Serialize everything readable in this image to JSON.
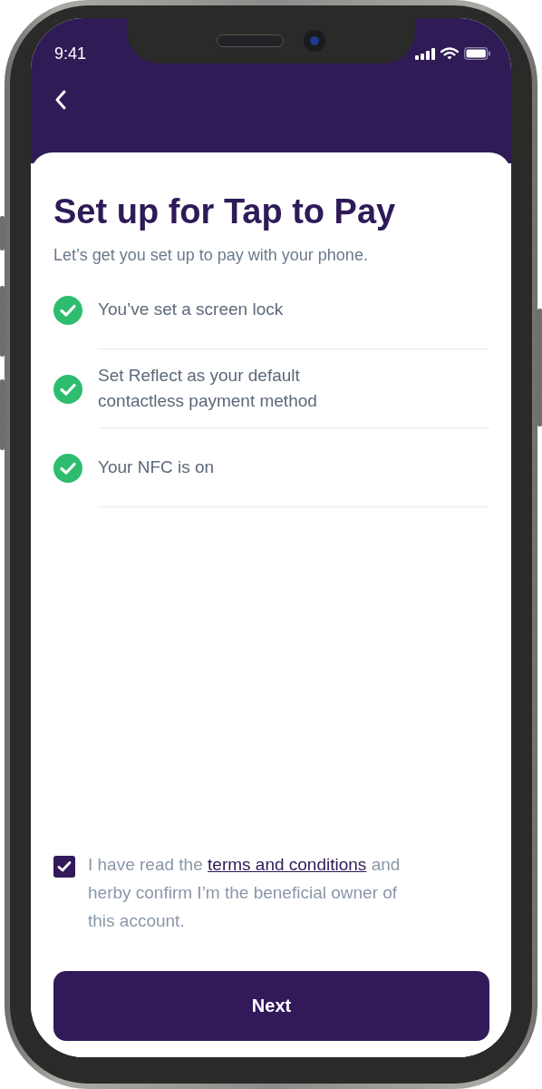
{
  "status_bar": {
    "time": "9:41"
  },
  "title": "Set up for Tap to Pay",
  "subtitle": "Let’s get you set up to pay with your phone.",
  "steps": [
    {
      "label": "You’ve set a screen lock",
      "done": true
    },
    {
      "label": "Set Reflect as your default contactless payment method",
      "done": true
    },
    {
      "label": "Your NFC is on",
      "done": true
    }
  ],
  "terms": {
    "checked": true,
    "text_before": "I have read the ",
    "link": "terms and conditions",
    "text_after": " and herby confirm I’m the beneficial owner of this account."
  },
  "button": "Next"
}
